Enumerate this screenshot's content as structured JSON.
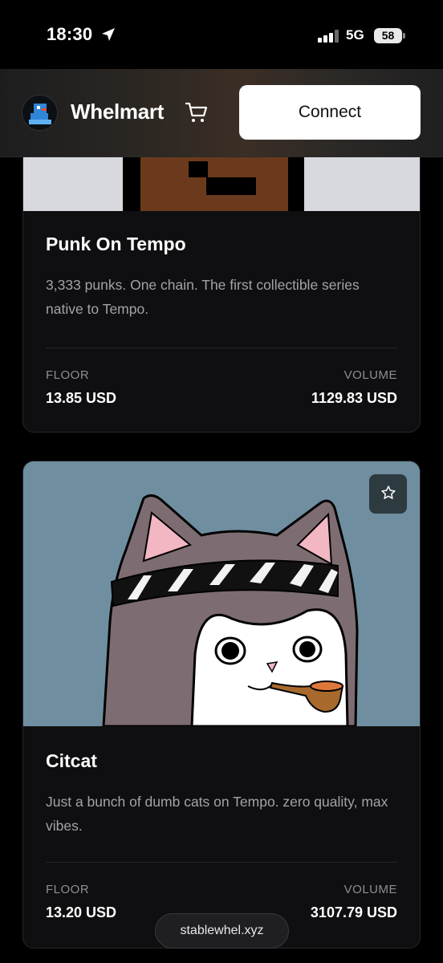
{
  "status_bar": {
    "time": "18:30",
    "network": "5G",
    "battery": "58"
  },
  "header": {
    "brand": "Whelmart",
    "connect_label": "Connect"
  },
  "collections": [
    {
      "title": "Punk On Tempo",
      "description": "3,333 punks. One chain. The first collectible series native to Tempo.",
      "floor_label": "FLOOR",
      "floor_value": "13.85 USD",
      "volume_label": "VOLUME",
      "volume_value": "1129.83 USD"
    },
    {
      "title": "Citcat",
      "description": "Just a bunch of dumb cats on Tempo. zero quality, max vibes.",
      "floor_label": "FLOOR",
      "floor_value": "13.20 USD",
      "volume_label": "VOLUME",
      "volume_value": "3107.79 USD"
    }
  ],
  "browser": {
    "url": "stablewhel.xyz"
  },
  "colors": {
    "background": "#000000",
    "card": "#0f0f11",
    "accent": "#ffffff",
    "muted": "#8d8d96"
  },
  "icons": [
    "location-arrow-icon",
    "signal-icon",
    "battery-icon",
    "cart-icon",
    "star-icon"
  ]
}
